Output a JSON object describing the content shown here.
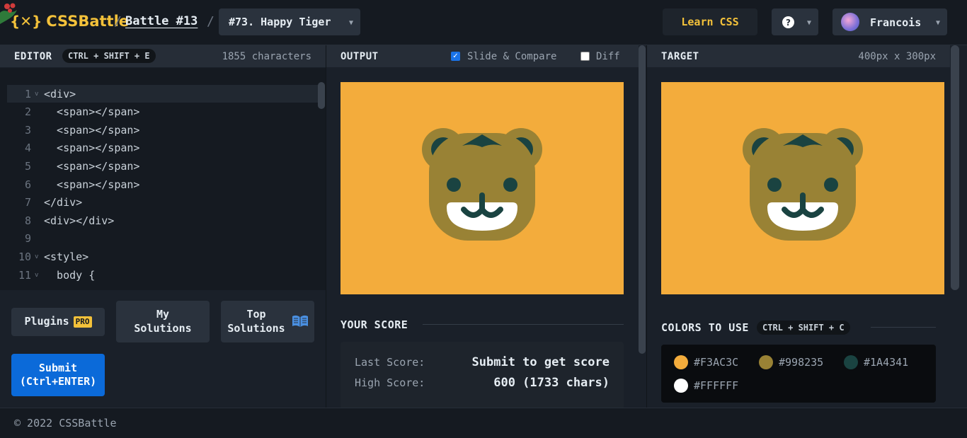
{
  "header": {
    "logo_text": "CSSBattle",
    "battle_link": "Battle #13",
    "separator": "/",
    "target_select": "#73. Happy Tiger",
    "learn_button": "Learn CSS",
    "help_glyph": "?",
    "user_name": "Francois"
  },
  "editor": {
    "title": "EDITOR",
    "shortcut": "CTRL + SHIFT + E",
    "char_count": "1855 characters",
    "lines": [
      {
        "num": "1",
        "text": "<div>",
        "fold": true,
        "active": true
      },
      {
        "num": "2",
        "text": "  <span></span>",
        "fold": false
      },
      {
        "num": "3",
        "text": "  <span></span>",
        "fold": false
      },
      {
        "num": "4",
        "text": "  <span></span>",
        "fold": false
      },
      {
        "num": "5",
        "text": "  <span></span>",
        "fold": false
      },
      {
        "num": "6",
        "text": "  <span></span>",
        "fold": false
      },
      {
        "num": "7",
        "text": "</div>",
        "fold": false
      },
      {
        "num": "8",
        "text": "<div></div>",
        "fold": false
      },
      {
        "num": "9",
        "text": "",
        "fold": false
      },
      {
        "num": "10",
        "text": "<style>",
        "fold": true
      },
      {
        "num": "11",
        "text": "  body {",
        "fold": true
      }
    ],
    "buttons": {
      "plugins": "Plugins",
      "pro_badge": "PRO",
      "my_solutions": "My Solutions",
      "top_solutions": "Top Solutions",
      "submit": "Submit (Ctrl+ENTER)"
    }
  },
  "output": {
    "title": "OUTPUT",
    "slide_compare_label": "Slide & Compare",
    "slide_compare_checked": true,
    "diff_label": "Diff",
    "diff_checked": false,
    "score_title": "YOUR SCORE",
    "last_score_label": "Last Score:",
    "last_score_value": "Submit to get score",
    "high_score_label": "High Score:",
    "high_score_value": "600 (1733 chars)"
  },
  "target": {
    "title": "TARGET",
    "dimensions": "400px x 300px",
    "colors_title": "COLORS TO USE",
    "colors_shortcut": "CTRL + SHIFT + C",
    "colors": [
      "#F3AC3C",
      "#998235",
      "#1A4341",
      "#FFFFFF"
    ]
  },
  "footer": {
    "copyright": "© 2022 CSSBattle"
  },
  "icons": {
    "holly": "holly-icon",
    "help": "help-icon",
    "book": "book-open-icon",
    "caret": "chevron-down-icon"
  }
}
